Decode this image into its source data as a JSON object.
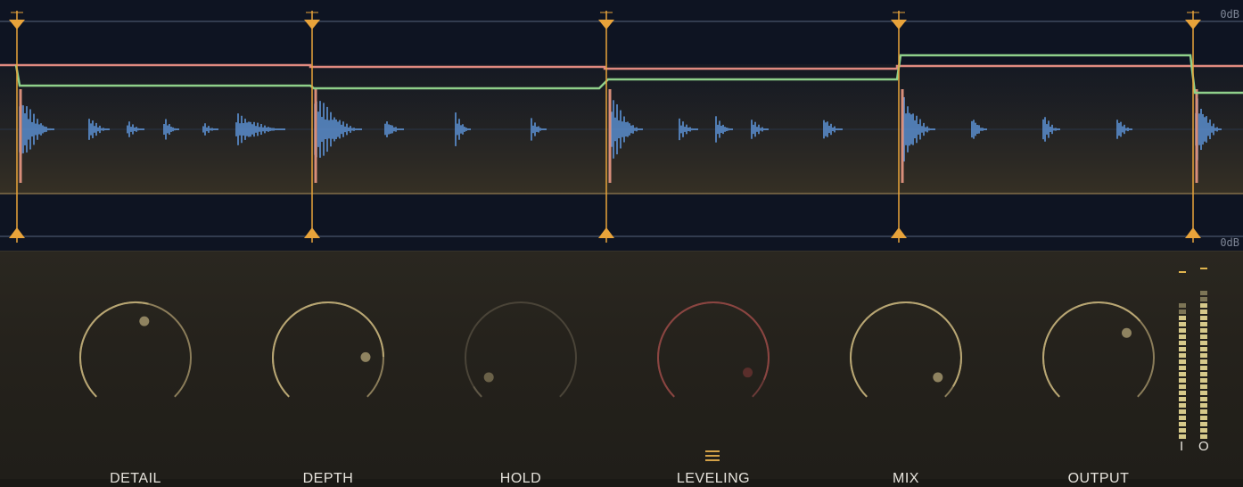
{
  "display": {
    "top_db_label": "0dB",
    "bottom_db_label": "0dB",
    "colors": {
      "background": "#0e1422",
      "marker": "#e8a33a",
      "waveform": "#5d93d6",
      "transient": "#d88e7a",
      "green_curve": "#8fd08a",
      "red_curve": "#e08a80",
      "gridline": "#3f4a5e",
      "threshold": "#7d6a48"
    }
  },
  "knobs": [
    {
      "id": "detail",
      "label": "DETAIL",
      "level": 0.55,
      "active": true
    },
    {
      "id": "depth",
      "label": "DEPTH",
      "level": 0.83,
      "active": true
    },
    {
      "id": "hold",
      "label": "HOLD",
      "level": 0.05,
      "active": false
    },
    {
      "id": "leveling",
      "label": "LEVELING",
      "level": 0.92,
      "active": false,
      "tint": "red"
    },
    {
      "id": "mix",
      "label": "MIX",
      "level": 0.95,
      "active": true
    },
    {
      "id": "output",
      "label": "OUTPUT",
      "level": 0.68,
      "active": true
    }
  ],
  "menu": {
    "icon": "hamburger-menu-icon"
  },
  "meters": {
    "input_label": "I",
    "output_label": "O",
    "input_level": 0.82,
    "output_level": 0.88
  }
}
